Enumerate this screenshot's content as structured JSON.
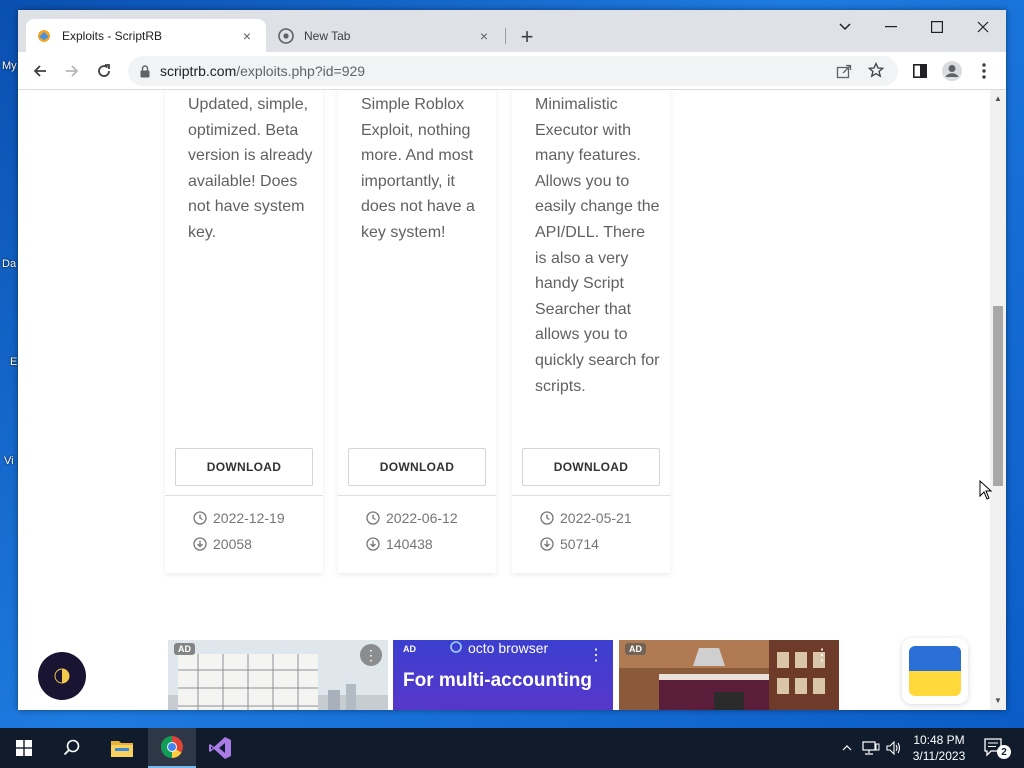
{
  "desktop": {
    "icon_labels": [
      "My",
      "Da",
      "E",
      "Vi"
    ]
  },
  "browser": {
    "tabs": [
      {
        "title": "Exploits - ScriptRB",
        "close": "×"
      },
      {
        "title": "New Tab",
        "close": "×"
      }
    ],
    "new_tab": "+",
    "url": {
      "host": "scriptrb.com",
      "path": "/exploits.php?id=929"
    }
  },
  "page": {
    "cards": [
      {
        "description": "Updated, simple, optimized. Beta version is already available! Does not have system key.",
        "download_label": "DOWNLOAD",
        "date": "2022-12-19",
        "downloads": "20058"
      },
      {
        "description": "Simple Roblox Exploit, nothing more. And most importantly, it does not have a key system!",
        "download_label": "DOWNLOAD",
        "date": "2022-06-12",
        "downloads": "140438"
      },
      {
        "description": "Minimalistic Executor with many features. Allows you to easily change the API/DLL. There is also a very handy Script Searcher that allows you to quickly search for scripts.",
        "download_label": "DOWNLOAD",
        "date": "2022-05-21",
        "downloads": "50714"
      }
    ],
    "ads": [
      {
        "tag": "AD",
        "menu": "⋮"
      },
      {
        "tag": "AD",
        "brand": "octo browser",
        "headline": "For multi-accounting",
        "menu": "⋮"
      },
      {
        "tag": "AD",
        "menu": "⋮"
      }
    ],
    "scroll_position": 0.42
  },
  "taskbar": {
    "time": "10:48 PM",
    "date": "3/11/2023",
    "notification_count": "2"
  },
  "colors": {
    "desktop_blue": "#1565c0",
    "tabstrip": "#dee1e6",
    "taskbar": "#101c2c",
    "ukraine_blue": "#2a6fd6",
    "ukraine_yellow": "#ffd83a"
  }
}
